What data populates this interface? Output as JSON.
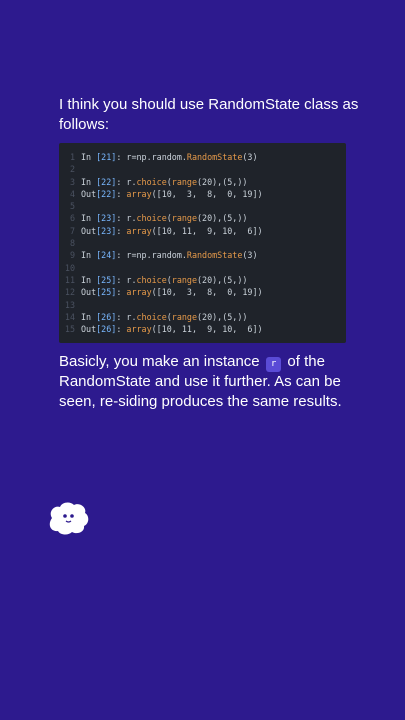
{
  "intro_text": "I think you should use RandomState class as follows:",
  "code_lines": [
    {
      "n": "1",
      "parts": [
        [
          "p",
          "In "
        ],
        [
          "num",
          "[21]"
        ],
        [
          "p",
          ": r=np.random."
        ],
        [
          "fn",
          "RandomState"
        ],
        [
          "p",
          "(3)"
        ]
      ]
    },
    {
      "n": "2",
      "parts": []
    },
    {
      "n": "3",
      "parts": [
        [
          "p",
          "In "
        ],
        [
          "num",
          "[22]"
        ],
        [
          "p",
          ": r."
        ],
        [
          "fn",
          "choice"
        ],
        [
          "p",
          "("
        ],
        [
          "fn",
          "range"
        ],
        [
          "p",
          "(20),(5,))"
        ]
      ]
    },
    {
      "n": "4",
      "parts": [
        [
          "p",
          "Out"
        ],
        [
          "num",
          "[22]"
        ],
        [
          "p",
          ": "
        ],
        [
          "fn",
          "array"
        ],
        [
          "p",
          "([10,  3,  8,  0, 19])"
        ]
      ]
    },
    {
      "n": "5",
      "parts": []
    },
    {
      "n": "6",
      "parts": [
        [
          "p",
          "In "
        ],
        [
          "num",
          "[23]"
        ],
        [
          "p",
          ": r."
        ],
        [
          "fn",
          "choice"
        ],
        [
          "p",
          "("
        ],
        [
          "fn",
          "range"
        ],
        [
          "p",
          "(20),(5,))"
        ]
      ]
    },
    {
      "n": "7",
      "parts": [
        [
          "p",
          "Out"
        ],
        [
          "num",
          "[23]"
        ],
        [
          "p",
          ": "
        ],
        [
          "fn",
          "array"
        ],
        [
          "p",
          "([10, 11,  9, 10,  6])"
        ]
      ]
    },
    {
      "n": "8",
      "parts": []
    },
    {
      "n": "9",
      "parts": [
        [
          "p",
          "In "
        ],
        [
          "num",
          "[24]"
        ],
        [
          "p",
          ": r=np.random."
        ],
        [
          "fn",
          "RandomState"
        ],
        [
          "p",
          "(3)"
        ]
      ]
    },
    {
      "n": "10",
      "parts": []
    },
    {
      "n": "11",
      "parts": [
        [
          "p",
          "In "
        ],
        [
          "num",
          "[25]"
        ],
        [
          "p",
          ": r."
        ],
        [
          "fn",
          "choice"
        ],
        [
          "p",
          "("
        ],
        [
          "fn",
          "range"
        ],
        [
          "p",
          "(20),(5,))"
        ]
      ]
    },
    {
      "n": "12",
      "parts": [
        [
          "p",
          "Out"
        ],
        [
          "num",
          "[25]"
        ],
        [
          "p",
          ": "
        ],
        [
          "fn",
          "array"
        ],
        [
          "p",
          "([10,  3,  8,  0, 19])"
        ]
      ]
    },
    {
      "n": "13",
      "parts": []
    },
    {
      "n": "14",
      "parts": [
        [
          "p",
          "In "
        ],
        [
          "num",
          "[26]"
        ],
        [
          "p",
          ": r."
        ],
        [
          "fn",
          "choice"
        ],
        [
          "p",
          "("
        ],
        [
          "fn",
          "range"
        ],
        [
          "p",
          "(20),(5,))"
        ]
      ]
    },
    {
      "n": "15",
      "parts": [
        [
          "p",
          "Out"
        ],
        [
          "num",
          "[26]"
        ],
        [
          "p",
          ": "
        ],
        [
          "fn",
          "array"
        ],
        [
          "p",
          "([10, 11,  9, 10,  6])"
        ]
      ]
    }
  ],
  "explain": {
    "before": "Basicly, you make an instance ",
    "code": "r",
    "after": " of the RandomState and use it further. As can be seen, re-siding produces the same results."
  },
  "colors": {
    "background": "#2d1a8e",
    "code_bg": "#1f232a",
    "inline_code_bg": "#5a4bd6"
  }
}
